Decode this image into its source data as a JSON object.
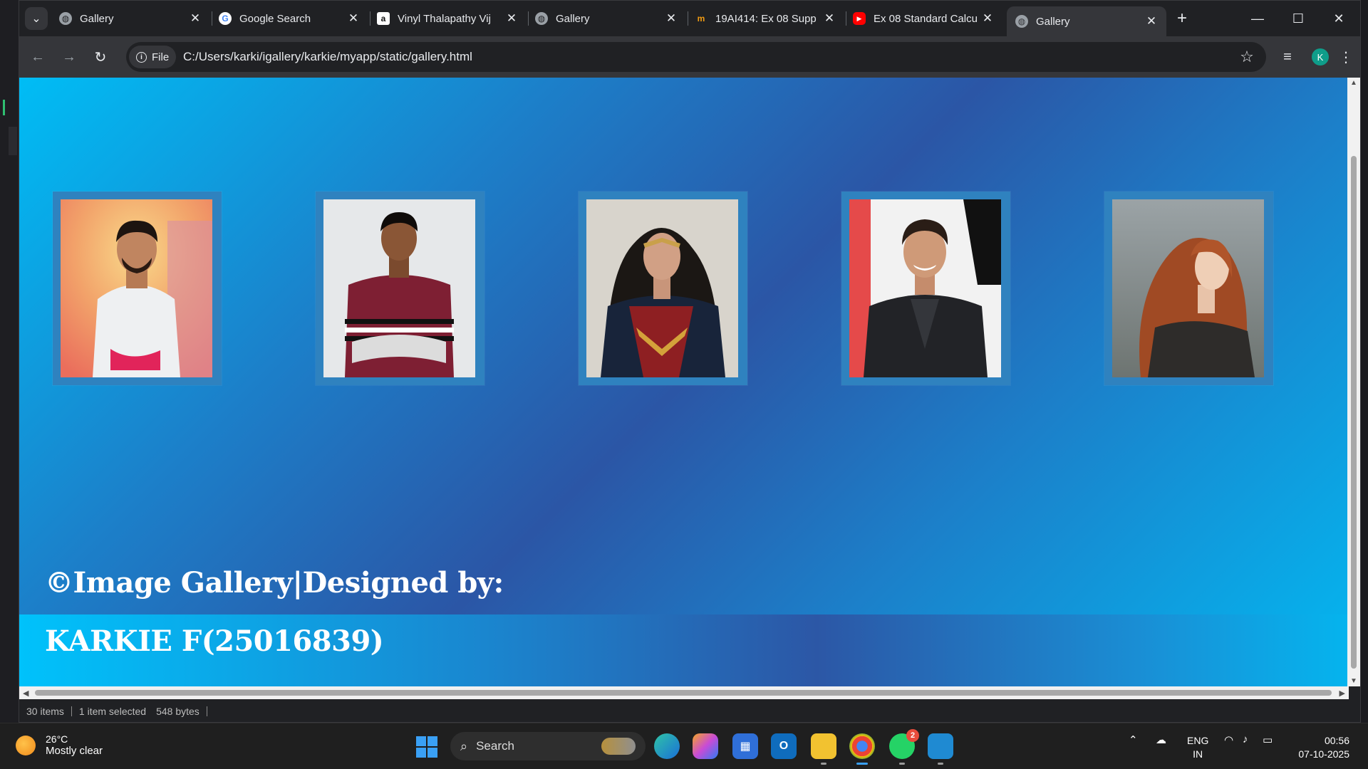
{
  "browser": {
    "tabs": [
      {
        "title": "Gallery",
        "favicon": "globe-icon",
        "active": false
      },
      {
        "title": "Google Search",
        "favicon": "google-icon",
        "active": false
      },
      {
        "title": "Vinyl Thalapathy Vij",
        "favicon": "amazon-icon",
        "active": false
      },
      {
        "title": "Gallery",
        "favicon": "globe-icon",
        "active": false
      },
      {
        "title": "19AI414: Ex 08 Supp",
        "favicon": "moodle-icon",
        "active": false
      },
      {
        "title": "Ex 08 Standard Calcu",
        "favicon": "youtube-icon",
        "active": false
      },
      {
        "title": "Gallery",
        "favicon": "globe-icon",
        "active": true
      }
    ],
    "site_chip": "File",
    "url": "C:/Users/karki/igallery/karkie/myapp/static/gallery.html",
    "profile_initial": "K"
  },
  "page": {
    "photos": [
      {
        "subject": "man-white-shirt"
      },
      {
        "subject": "young-man-striped-tshirt"
      },
      {
        "subject": "woman-warrior-costume"
      },
      {
        "subject": "man-dark-suit"
      },
      {
        "subject": "woman-red-hair"
      }
    ],
    "footer_line1": "©Image Gallery|Designed by:",
    "footer_line2": "KARKIE F(25016839)"
  },
  "status_bar": {
    "items_count": "30 items",
    "selection": "1 item selected",
    "size": "548 bytes"
  },
  "taskbar": {
    "weather_temp": "26°C",
    "weather_desc": "Mostly clear",
    "search_label": "Search",
    "whatsapp_badge": "2",
    "lang_line1": "ENG",
    "lang_line2": "IN",
    "time": "00:56",
    "date": "07-10-2025"
  },
  "colors": {
    "accent": "#3aa0f5",
    "page_gradient_light": "#00bdf5",
    "page_gradient_dark": "#2b56a6",
    "frame": "#2f82bf"
  }
}
